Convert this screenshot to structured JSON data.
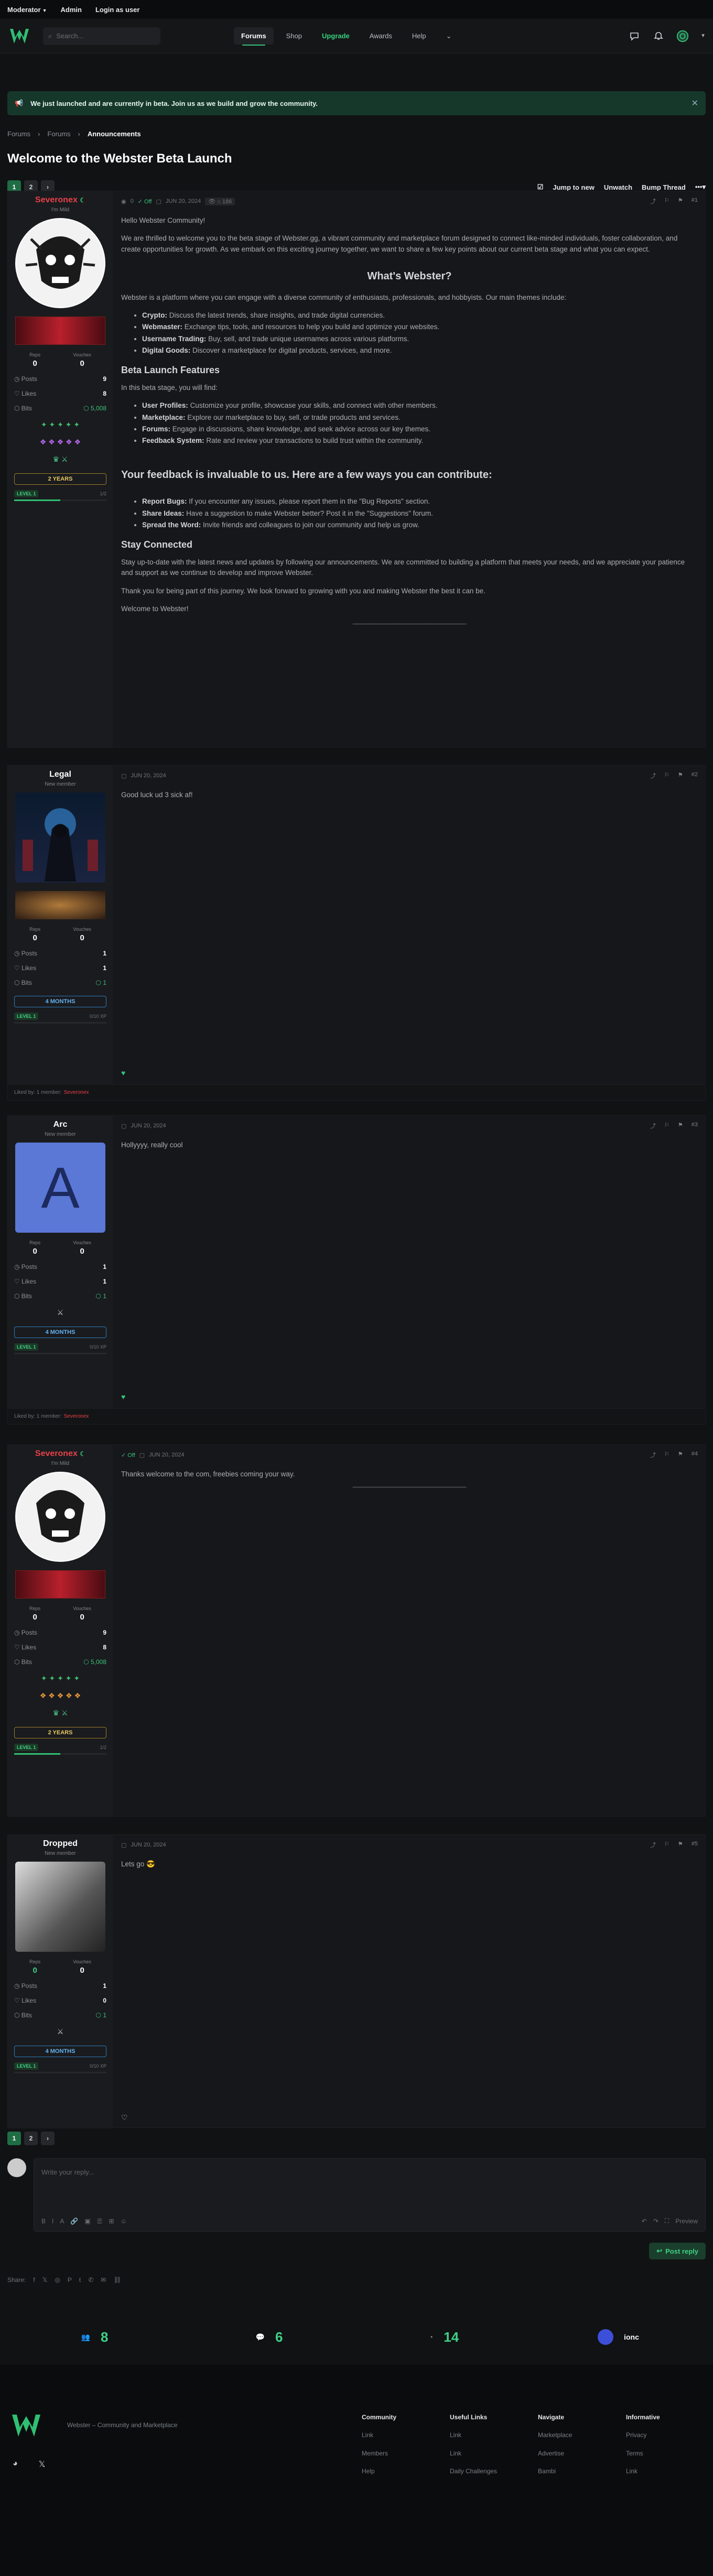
{
  "topbar": {
    "moderator": "Moderator",
    "admin": "Admin",
    "login": "Login as user"
  },
  "nav": {
    "search_placeholder": "Search...",
    "links": [
      {
        "label": "Forums"
      },
      {
        "label": "Shop"
      },
      {
        "label": "Upgrade"
      },
      {
        "label": "Awards"
      },
      {
        "label": "Help"
      }
    ]
  },
  "banner": {
    "text": "We just launched and are currently in beta. Join us as we build and grow the community."
  },
  "breadcrumbs": [
    "Forums",
    "Forums",
    "Announcements"
  ],
  "thread_title": "Welcome to the Webster Beta Launch",
  "pagination": {
    "pages": [
      "1",
      "2"
    ],
    "next": "›"
  },
  "actions": {
    "jump": "Jump to new",
    "unwatch": "Unwatch",
    "bump": "Bump Thread"
  },
  "posts": [
    {
      "author": {
        "name": "Severonex",
        "title": "I'm Mild",
        "reps": "0",
        "vouches": "0",
        "posts": "9",
        "likes": "8",
        "bits": "5,008",
        "years": "2 YEARS",
        "level": "LEVEL 1",
        "xp": "1/2"
      },
      "meta": {
        "date": "JUN 20, 2024",
        "views": "0",
        "off": "Off",
        "id": "#1"
      },
      "content": {
        "greeting": "Hello Webster Community!",
        "intro": "We are thrilled to welcome you to the beta stage of Webster.gg, a vibrant community and marketplace forum designed to connect like-minded individuals, foster collaboration, and create opportunities for growth. As we embark on this exciting journey together, we want to share a few key points about our current beta stage and what you can expect.",
        "h_what": "What's Webster?",
        "what_p": "Webster is a platform where you can engage with a diverse community of enthusiasts, professionals, and hobbyists. Our main themes include:",
        "themes": [
          {
            "k": "Crypto:",
            "v": "Discuss the latest trends, share insights, and trade digital currencies."
          },
          {
            "k": "Webmaster:",
            "v": "Exchange tips, tools, and resources to help you build and optimize your websites."
          },
          {
            "k": "Username Trading:",
            "v": "Buy, sell, and trade unique usernames across various platforms."
          },
          {
            "k": "Digital Goods:",
            "v": "Discover a marketplace for digital products, services, and more."
          }
        ],
        "h_beta": "Beta Launch Features",
        "beta_p": "In this beta stage, you will find:",
        "features": [
          {
            "k": "User Profiles:",
            "v": "Customize your profile, showcase your skills, and connect with other members."
          },
          {
            "k": "Marketplace:",
            "v": "Explore our marketplace to buy, sell, or trade products and services."
          },
          {
            "k": "Forums:",
            "v": "Engage in discussions, share knowledge, and seek advice across our key themes."
          },
          {
            "k": "Feedback System:",
            "v": "Rate and review your transactions to build trust within the community."
          }
        ],
        "h_feedback": "Your feedback is invaluable to us. Here are a few ways you can contribute:",
        "contrib": [
          {
            "k": "Report Bugs:",
            "v": "If you encounter any issues, please report them in the \"Bug Reports\" section."
          },
          {
            "k": "Share Ideas:",
            "v": "Have a suggestion to make Webster better? Post it in the \"Suggestions\" forum."
          },
          {
            "k": "Spread the Word:",
            "v": "Invite friends and colleagues to join our community and help us grow."
          }
        ],
        "h_stay": "Stay Connected",
        "stay_p": "Stay up-to-date with the latest news and updates by following our announcements. We are committed to building a platform that meets your needs, and we appreciate your patience and support as we continue to develop and improve Webster.",
        "thanks": "Thank you for being part of this journey. We look forward to growing with you and making Webster the best it can be.",
        "welcome": "Welcome to Webster!"
      }
    },
    {
      "author": {
        "name": "Legal",
        "title": "New member",
        "reps": "0",
        "vouches": "0",
        "posts": "1",
        "likes": "1",
        "bits": "1",
        "years": "4 MONTHS",
        "level": "LEVEL 1",
        "xp": "0/10 XP"
      },
      "meta": {
        "date": "JUN 20, 2024",
        "id": "#2"
      },
      "text": "Good luck ud 3 sick af!",
      "liked": "Liked by: 1 member:",
      "liked_name": "Severonex"
    },
    {
      "author": {
        "name": "Arc",
        "title": "New member",
        "letter": "A",
        "reps": "0",
        "vouches": "0",
        "posts": "1",
        "likes": "1",
        "bits": "1",
        "years": "4 MONTHS",
        "level": "LEVEL 1",
        "xp": "0/10 XP"
      },
      "meta": {
        "date": "JUN 20, 2024",
        "id": "#3"
      },
      "text": "Hollyyyy, really cool",
      "liked": "Liked by: 1 member:",
      "liked_name": "Severonex"
    },
    {
      "author": {
        "name": "Severonex",
        "title": "I'm Mild",
        "reps": "0",
        "vouches": "0",
        "posts": "9",
        "likes": "8",
        "bits": "5,008",
        "years": "2 YEARS",
        "level": "LEVEL 1",
        "xp": "1/2"
      },
      "meta": {
        "date": "JUN 20, 2024",
        "off": "Off",
        "id": "#4"
      },
      "text": "Thanks welcome to the com, freebies coming your way."
    },
    {
      "author": {
        "name": "Dropped",
        "title": "New member",
        "reps": "0",
        "vouches": "0",
        "posts": "1",
        "likes": "0",
        "bits": "1",
        "years": "4 MONTHS",
        "level": "LEVEL 1",
        "xp": "0/10 XP"
      },
      "meta": {
        "date": "JUN 20, 2024",
        "id": "#5"
      },
      "text": "Lets go 😎"
    }
  ],
  "editor": {
    "placeholder": "Write your reply...",
    "preview": "Preview"
  },
  "reply_button": "Post reply",
  "share_label": "Share:",
  "stats": {
    "members": "8",
    "threads": "6",
    "online": "14",
    "ionc": "ionc"
  },
  "footer": {
    "tagline": "Webster – Community and Marketplace",
    "cols": [
      {
        "head": "Community",
        "items": [
          "Link",
          "Members",
          "Help"
        ]
      },
      {
        "head": "Useful Links",
        "items": [
          "Link",
          "Link",
          "Daily Challenges"
        ]
      },
      {
        "head": "Navigate",
        "items": [
          "Marketplace",
          "Advertise",
          "Bambi"
        ]
      },
      {
        "head": "Informative",
        "items": [
          "Privacy",
          "Terms",
          "Link"
        ]
      }
    ]
  },
  "colors": {
    "accent": "#36c07b",
    "danger": "#e5414a",
    "bg": "#111214"
  }
}
